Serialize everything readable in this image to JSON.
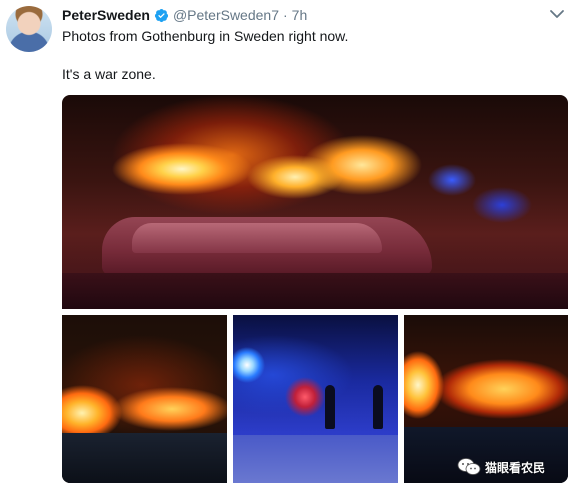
{
  "tweet": {
    "author_name": "PeterSweden",
    "verified": true,
    "handle": "@PeterSweden7",
    "separator": "·",
    "time": "7h",
    "text_line1": "Photos from Gothenburg in Sweden right now.",
    "text_line2": "It's a war zone."
  },
  "icons": {
    "verified": "verified-badge-icon",
    "menu": "chevron-down-icon",
    "watermark": "wechat-logo-icon"
  },
  "media": {
    "photo_count": 4
  },
  "watermark": {
    "text": "猫眼看农民"
  },
  "colors": {
    "verified_blue": "#1da1f2",
    "secondary_text": "#657786"
  }
}
